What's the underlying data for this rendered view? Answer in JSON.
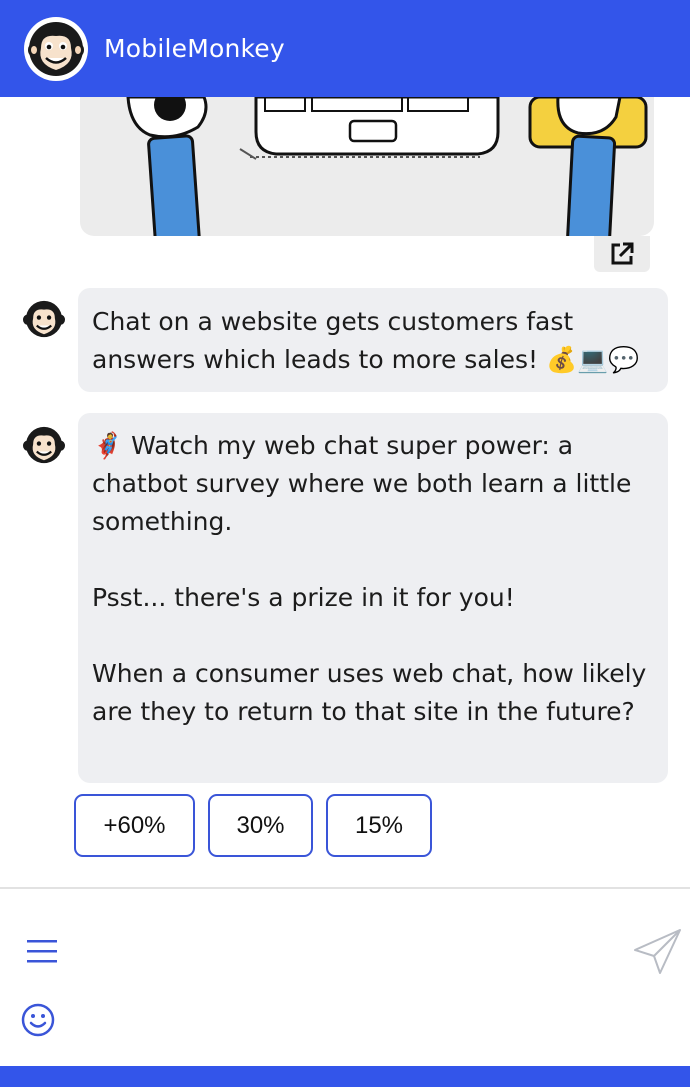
{
  "header": {
    "title": "MobileMonkey",
    "logo_icon": "monkey-logo-icon"
  },
  "theme": {
    "brand_blue": "#3355ea",
    "bubble_bg": "#eeeff2",
    "button_border": "#3a55d8"
  },
  "image_card": {
    "illustration": "hands-typing-keyboard-illustration",
    "open_icon": "external-link-icon"
  },
  "messages": [
    {
      "avatar_icon": "monkey-avatar-icon",
      "text": "Chat on a website gets customers fast answers which leads to more sales! 💰💻💬"
    },
    {
      "avatar_icon": "monkey-avatar-icon",
      "text": "🦸 Watch my web chat super power: a chatbot survey where we both learn a little something.\n\nPsst... there's a prize in it for you!\n\nWhen a consumer uses web chat, how likely are they to return to that site in the future?"
    }
  ],
  "quick_replies": [
    {
      "label": "+60%"
    },
    {
      "label": "30%"
    },
    {
      "label": "15%"
    }
  ],
  "composer": {
    "menu_icon": "hamburger-menu-icon",
    "emoji_icon": "smiley-icon",
    "send_icon": "paper-plane-icon"
  }
}
